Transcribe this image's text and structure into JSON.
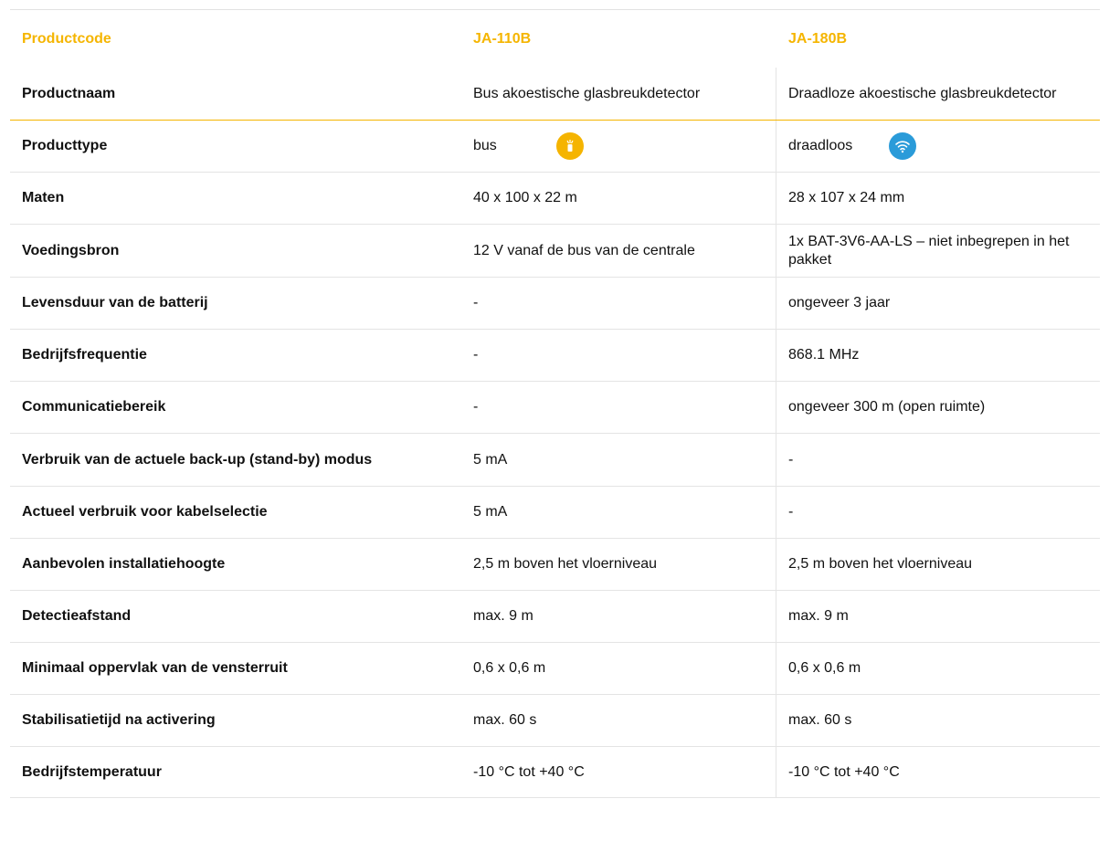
{
  "header": {
    "label": "Productcode",
    "product_a": "JA-110B",
    "product_b": "JA-180B"
  },
  "colors": {
    "accent": "#f5b500",
    "bus_badge": "#f5b400",
    "wireless_badge": "#2a9bd9",
    "divider": "#e4e4e4"
  },
  "icons": {
    "bus": "bus-wire-icon",
    "wireless": "wifi-icon"
  },
  "rows": [
    {
      "label": "Productnaam",
      "a": "Bus akoestische glasbreukdetector",
      "b": "Draadloze akoestische glasbreukdetector"
    },
    {
      "label": "Producttype",
      "a": "bus",
      "b": "draadloos"
    },
    {
      "label": "Maten",
      "a": "40 x 100 x 22 m",
      "b": "28 x 107 x 24 mm"
    },
    {
      "label": "Voedingsbron",
      "a": "12 V vanaf de bus van de centrale",
      "b": "1x BAT-3V6-AA-LS – niet inbegrepen in het pakket"
    },
    {
      "label": "Levensduur van de batterij",
      "a": "-",
      "b": "ongeveer 3 jaar"
    },
    {
      "label": "Bedrijfsfrequentie",
      "a": "-",
      "b": "868.1 MHz"
    },
    {
      "label": "Communicatiebereik",
      "a": "-",
      "b": "ongeveer 300 m (open ruimte)"
    },
    {
      "label": "Verbruik van de actuele back-up (stand-by) modus",
      "a": "5 mA",
      "b": "-"
    },
    {
      "label": "Actueel verbruik voor kabelselectie",
      "a": "5 mA",
      "b": "-"
    },
    {
      "label": "Aanbevolen installatiehoogte",
      "a": "2,5 m boven het vloerniveau",
      "b": "2,5 m boven het vloerniveau"
    },
    {
      "label": "Detectieafstand",
      "a": "max. 9 m",
      "b": "max. 9 m"
    },
    {
      "label": "Minimaal oppervlak van de vensterruit",
      "a": "0,6 x 0,6 m",
      "b": "0,6 x 0,6 m"
    },
    {
      "label": "Stabilisatietijd na activering",
      "a": "max. 60 s",
      "b": "max. 60 s"
    },
    {
      "label": "Bedrijfstemperatuur",
      "a": "-10 °C tot +40 °C",
      "b": "-10 °C tot +40 °C"
    }
  ]
}
